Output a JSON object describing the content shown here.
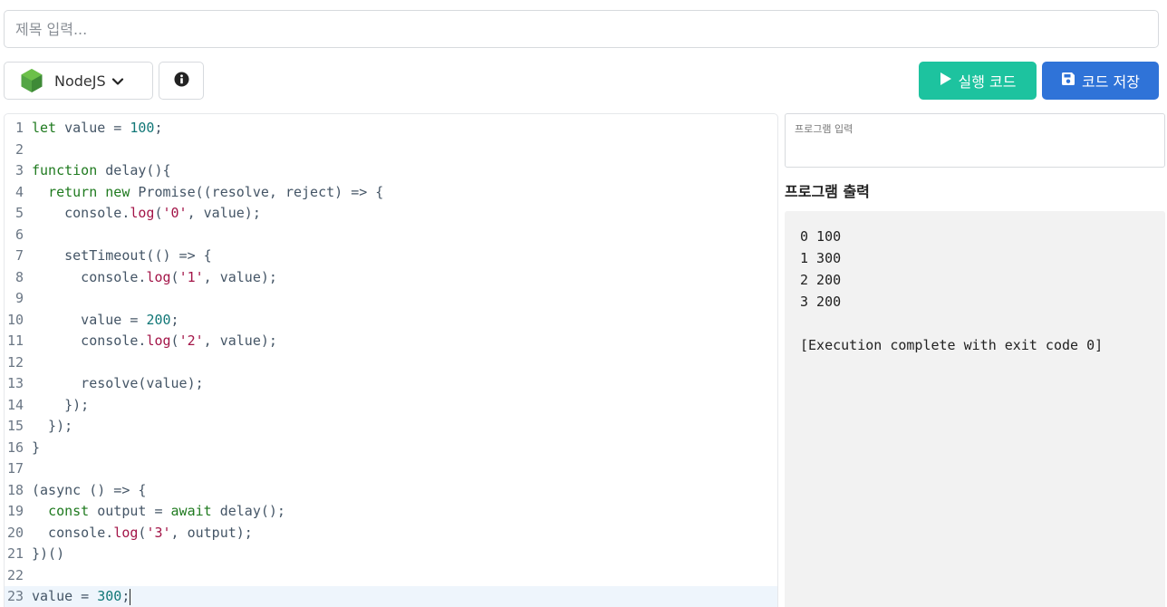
{
  "title_input": {
    "placeholder": "제목 입력...",
    "value": ""
  },
  "toolbar": {
    "language": "NodeJS",
    "run_label": "실행 코드",
    "save_label": "코드 저장"
  },
  "editor": {
    "active_line": 23,
    "lines": [
      [
        {
          "t": "kw",
          "v": "let"
        },
        {
          "t": "p",
          "v": " value = "
        },
        {
          "t": "num",
          "v": "100"
        },
        {
          "t": "p",
          "v": ";"
        }
      ],
      [],
      [
        {
          "t": "kw",
          "v": "function"
        },
        {
          "t": "p",
          "v": " delay(){"
        }
      ],
      [
        {
          "t": "p",
          "v": "  "
        },
        {
          "t": "kw",
          "v": "return"
        },
        {
          "t": "p",
          "v": " "
        },
        {
          "t": "kw",
          "v": "new"
        },
        {
          "t": "p",
          "v": " Promise((resolve, reject) => {"
        }
      ],
      [
        {
          "t": "p",
          "v": "    console."
        },
        {
          "t": "prop",
          "v": "log"
        },
        {
          "t": "p",
          "v": "("
        },
        {
          "t": "str",
          "v": "'0'"
        },
        {
          "t": "p",
          "v": ", value);"
        }
      ],
      [],
      [
        {
          "t": "p",
          "v": "    setTimeout(() => {"
        }
      ],
      [
        {
          "t": "p",
          "v": "      console."
        },
        {
          "t": "prop",
          "v": "log"
        },
        {
          "t": "p",
          "v": "("
        },
        {
          "t": "str",
          "v": "'1'"
        },
        {
          "t": "p",
          "v": ", value);"
        }
      ],
      [],
      [
        {
          "t": "p",
          "v": "      value = "
        },
        {
          "t": "num",
          "v": "200"
        },
        {
          "t": "p",
          "v": ";"
        }
      ],
      [
        {
          "t": "p",
          "v": "      console."
        },
        {
          "t": "prop",
          "v": "log"
        },
        {
          "t": "p",
          "v": "("
        },
        {
          "t": "str",
          "v": "'2'"
        },
        {
          "t": "p",
          "v": ", value);"
        }
      ],
      [],
      [
        {
          "t": "p",
          "v": "      resolve(value);"
        }
      ],
      [
        {
          "t": "p",
          "v": "    });"
        }
      ],
      [
        {
          "t": "p",
          "v": "  });"
        }
      ],
      [
        {
          "t": "p",
          "v": "}"
        }
      ],
      [],
      [
        {
          "t": "p",
          "v": "(async () => {"
        }
      ],
      [
        {
          "t": "p",
          "v": "  "
        },
        {
          "t": "kw",
          "v": "const"
        },
        {
          "t": "p",
          "v": " output = "
        },
        {
          "t": "kw",
          "v": "await"
        },
        {
          "t": "p",
          "v": " delay();"
        }
      ],
      [
        {
          "t": "p",
          "v": "  console."
        },
        {
          "t": "prop",
          "v": "log"
        },
        {
          "t": "p",
          "v": "("
        },
        {
          "t": "str",
          "v": "'3'"
        },
        {
          "t": "p",
          "v": ", output);"
        }
      ],
      [
        {
          "t": "p",
          "v": "})()"
        }
      ],
      [],
      [
        {
          "t": "p",
          "v": "value = "
        },
        {
          "t": "num",
          "v": "300"
        },
        {
          "t": "p",
          "v": ";"
        }
      ]
    ]
  },
  "program_input": {
    "placeholder": "프로그램 입력"
  },
  "program_output": {
    "title": "프로그램 출력",
    "lines": [
      "0 100",
      "1 300",
      "2 200",
      "3 200",
      "",
      "[Execution complete with exit code 0]"
    ]
  },
  "colors": {
    "run_button": "#1dc39f",
    "save_button": "#2f73d8",
    "node_green": "#53a545",
    "keyword": "#1f7a1f",
    "number": "#117777",
    "string": "#a31548"
  },
  "icons": {
    "language": "nodejs-hexagon-icon",
    "dropdown": "chevron-down-icon",
    "info": "info-circle-icon",
    "run": "play-icon",
    "save": "floppy-disk-icon"
  }
}
